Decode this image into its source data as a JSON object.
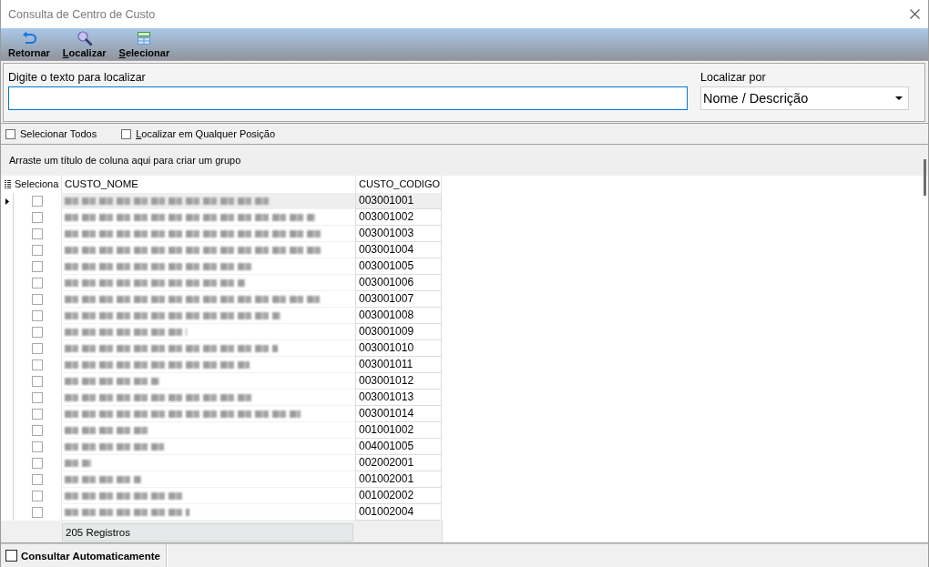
{
  "window": {
    "title": "Consulta de Centro de Custo"
  },
  "toolbar": [
    {
      "kind": "back",
      "label": "Retornar",
      "mnemonic": false
    },
    {
      "kind": "search",
      "label": "Localizar",
      "mnemonic": true
    },
    {
      "kind": "select",
      "label": "Selecionar",
      "mnemonic": true
    }
  ],
  "search": {
    "label": "Digite o texto para localizar"
  },
  "search_by": {
    "label": "Localizar por",
    "value": "Nome / Descrição"
  },
  "options": [
    {
      "label": "Selecionar Todos",
      "checked": false,
      "mnemonic": false
    },
    {
      "label": "Localizar em Qualquer Posição",
      "checked": false,
      "mnemonic": true
    }
  ],
  "grid": {
    "group_hint": "Arraste um título de coluna aqui para criar um grupo",
    "columns": [
      "Seleciona",
      "CUSTO_NOME",
      "CUSTO_CODIGO"
    ],
    "rows": [
      {
        "selected": true,
        "checked": false,
        "code": "003001001"
      },
      {
        "selected": false,
        "checked": false,
        "code": "003001002"
      },
      {
        "selected": false,
        "checked": false,
        "code": "003001003"
      },
      {
        "selected": false,
        "checked": false,
        "code": "003001004"
      },
      {
        "selected": false,
        "checked": false,
        "code": "003001005"
      },
      {
        "selected": false,
        "checked": false,
        "code": "003001006"
      },
      {
        "selected": false,
        "checked": false,
        "code": "003001007"
      },
      {
        "selected": false,
        "checked": false,
        "code": "003001008"
      },
      {
        "selected": false,
        "checked": false,
        "code": "003001009"
      },
      {
        "selected": false,
        "checked": false,
        "code": "003001010"
      },
      {
        "selected": false,
        "checked": false,
        "code": "003001011"
      },
      {
        "selected": false,
        "checked": false,
        "code": "003001012"
      },
      {
        "selected": false,
        "checked": false,
        "code": "003001013"
      },
      {
        "selected": false,
        "checked": false,
        "code": "003001014"
      },
      {
        "selected": false,
        "checked": false,
        "code": "001001002"
      },
      {
        "selected": false,
        "checked": false,
        "code": "004001005"
      },
      {
        "selected": false,
        "checked": false,
        "code": "002002001"
      },
      {
        "selected": false,
        "checked": false,
        "code": "001002001"
      },
      {
        "selected": false,
        "checked": false,
        "code": "001002002"
      },
      {
        "selected": false,
        "checked": false,
        "code": "001002004"
      }
    ],
    "footer": "205 Registros"
  },
  "status_bar": {
    "auto_query": {
      "label": "Consultar Automaticamente",
      "checked": false
    }
  }
}
